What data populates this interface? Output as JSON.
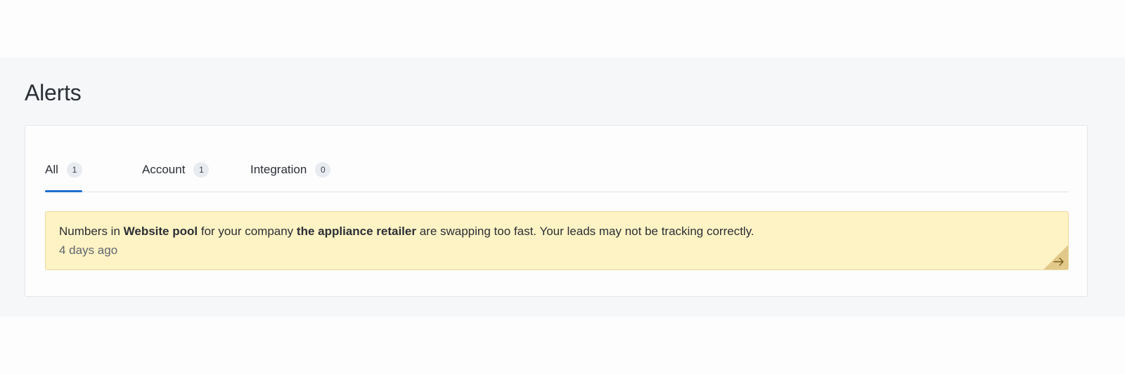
{
  "page": {
    "title": "Alerts"
  },
  "tabs": [
    {
      "label": "All",
      "count": "1",
      "active": true
    },
    {
      "label": "Account",
      "count": "1",
      "active": false
    },
    {
      "label": "Integration",
      "count": "0",
      "active": false
    }
  ],
  "alerts": [
    {
      "message_prefix": "Numbers in ",
      "pool_name": "Website pool",
      "message_middle": " for your company ",
      "company_name": "the appliance retailer",
      "message_suffix": " are swapping too fast. Your leads may not be tracking correctly.",
      "time_ago": "4 days ago",
      "action_icon": "arrow-right-icon"
    }
  ],
  "colors": {
    "accent": "#1f6fd1",
    "alert_background": "#fef3c4",
    "alert_border": "#ead8a0",
    "page_background": "#f6f7f8"
  }
}
